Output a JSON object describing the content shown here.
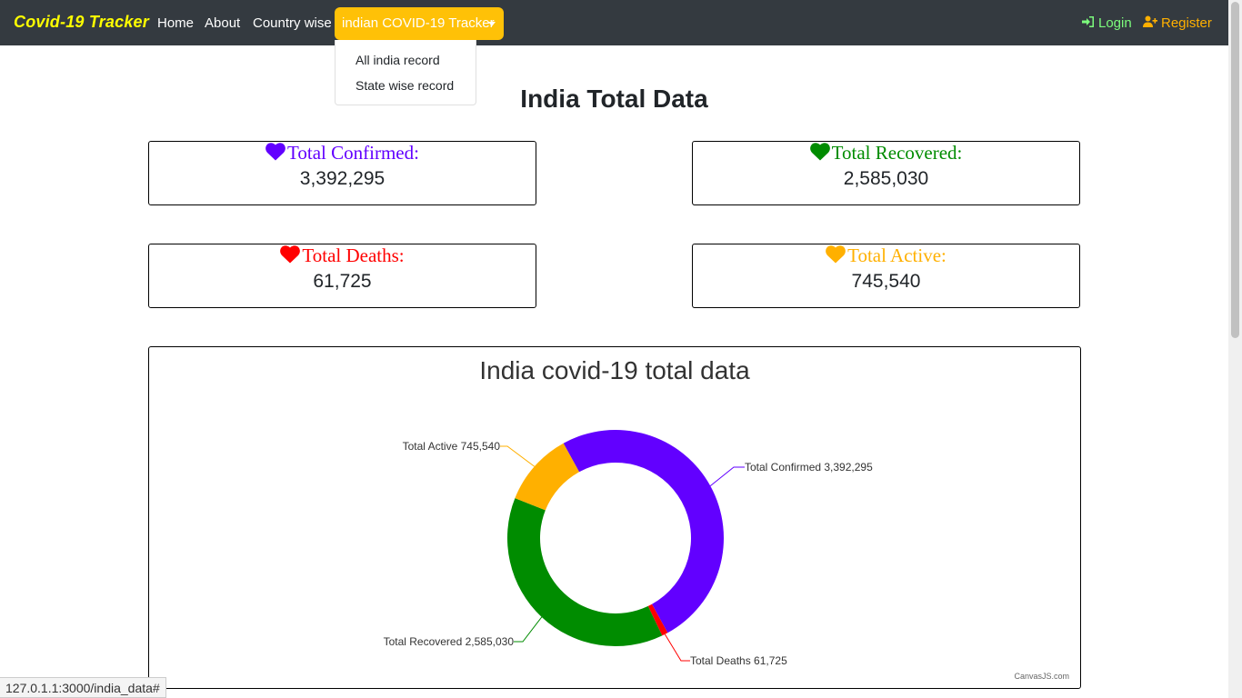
{
  "navbar": {
    "brand": "Covid-19 Tracker",
    "links": [
      "Home",
      "About",
      "Country wise"
    ],
    "dropdown_label": "indian COVID-19 Tracker",
    "dropdown_items": [
      "All india record",
      "State wise record"
    ],
    "login": "Login",
    "register": "Register"
  },
  "page": {
    "title": "India Total Data"
  },
  "stats": {
    "confirmed": {
      "label": "Total Confirmed:",
      "value": "3,392,295",
      "color": "#6200ff"
    },
    "recovered": {
      "label": "Total Recovered:",
      "value": "2,585,030",
      "color": "#008c00"
    },
    "deaths": {
      "label": "Total Deaths:",
      "value": "61,725",
      "color": "#ff0000"
    },
    "active": {
      "label": "Total Active:",
      "value": "745,540",
      "color": "#ffb000"
    }
  },
  "chart_data": {
    "type": "pie",
    "title": "India covid-19 total data",
    "series": [
      {
        "name": "Total Confirmed",
        "value": 3392295,
        "display": "3,392,295",
        "color": "#6200ff"
      },
      {
        "name": "Total Deaths",
        "value": 61725,
        "display": "61,725",
        "color": "#ff0000"
      },
      {
        "name": "Total Recovered",
        "value": 2585030,
        "display": "2,585,030",
        "color": "#008c00"
      },
      {
        "name": "Total Active",
        "value": 745540,
        "display": "745,540",
        "color": "#ffb000"
      }
    ],
    "credit": "CanvasJS.com"
  },
  "status_bar": {
    "url": "127.0.1.1:3000/india_data#"
  }
}
